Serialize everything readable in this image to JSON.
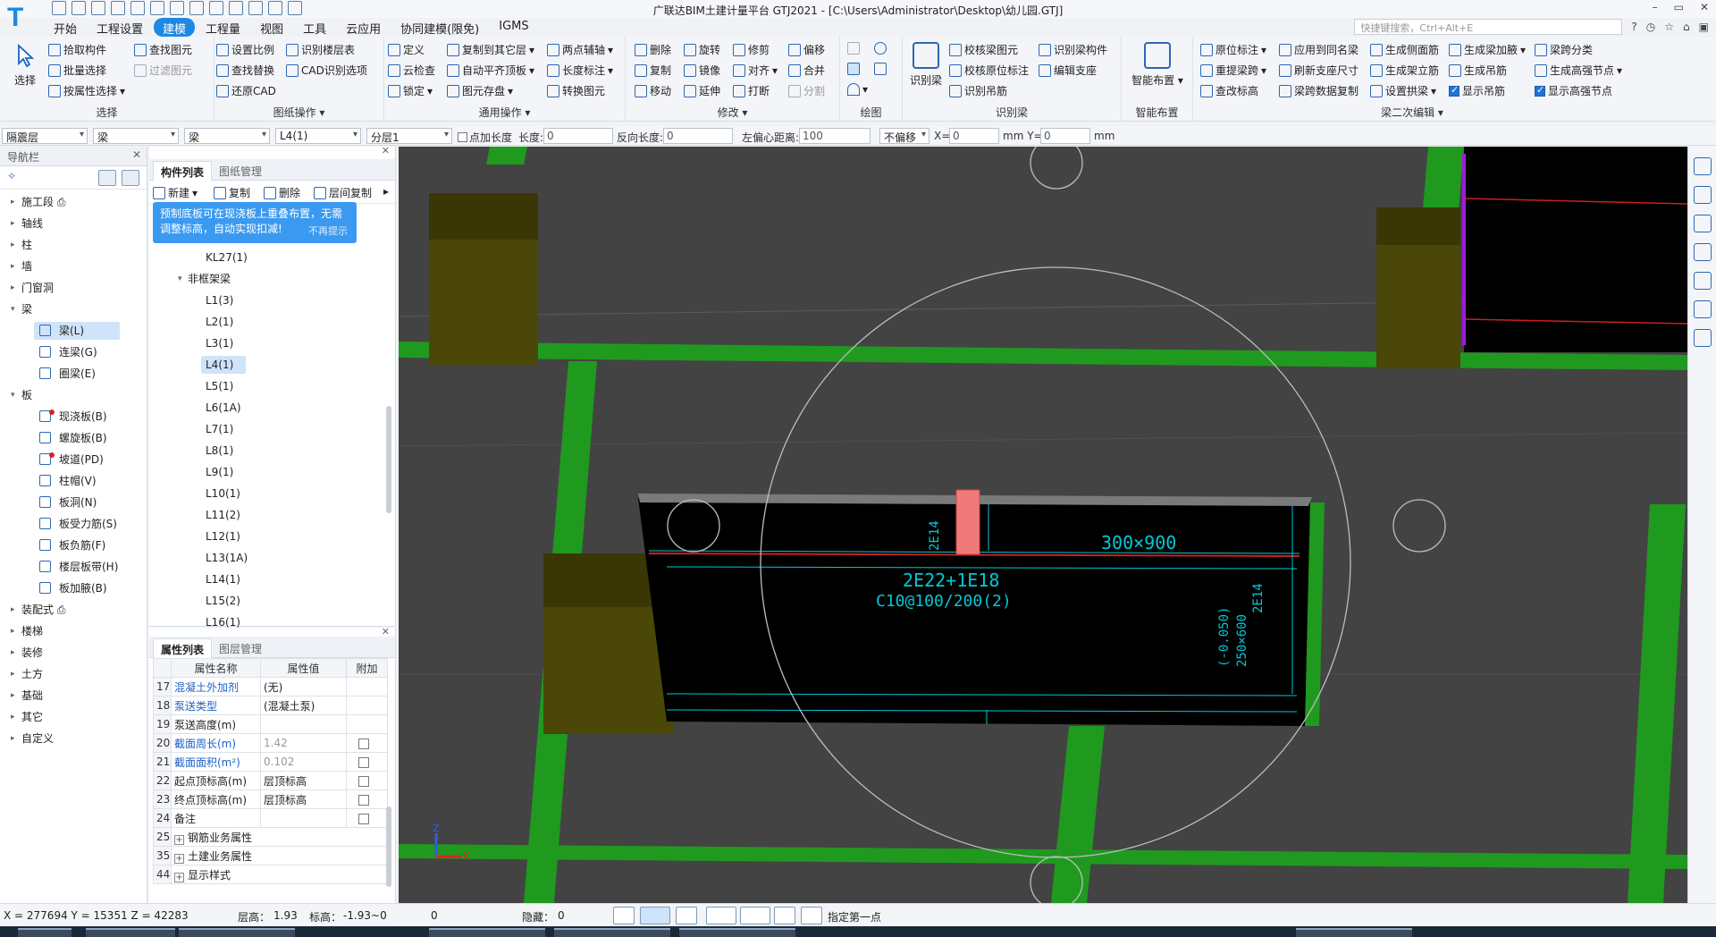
{
  "window": {
    "title": "广联达BIM土建计量平台 GTJ2021 - [C:\\Users\\Administrator\\Desktop\\幼儿园.GTJ]",
    "logo": "T",
    "quick_access_icons": [
      "new-file-icon",
      "open-folder-icon",
      "save-icon",
      "print-icon",
      "view-icon",
      "undo-icon",
      "redo-icon",
      "sum-icon",
      "grid-icon",
      "table-icon",
      "report-icon",
      "settings-icon",
      "dropdown-icon"
    ],
    "window_buttons": [
      "?",
      "◷",
      "☆",
      "⌂",
      "▣"
    ]
  },
  "menu": {
    "tabs": [
      {
        "label": "开始"
      },
      {
        "label": "工程设置"
      },
      {
        "label": "建模",
        "active": true
      },
      {
        "label": "工程量"
      },
      {
        "label": "视图"
      },
      {
        "label": "工具"
      },
      {
        "label": "云应用"
      },
      {
        "label": "协同建模(限免)"
      },
      {
        "label": "IGMS"
      }
    ],
    "search_placeholder": "快捷键搜索，Ctrl+Alt+E"
  },
  "ribbon": {
    "select_big": "选择",
    "select_group": {
      "title": "选择",
      "items": [
        "拾取构件",
        "批量选择",
        "按属性选择",
        "查找图元",
        "过滤图元"
      ]
    },
    "drawing_group": {
      "title": "图纸操作",
      "items": [
        "设置比例",
        "查找替换",
        "还原CAD",
        "识别楼层表",
        "CAD识别选项"
      ]
    },
    "common_group": {
      "title": "通用操作",
      "items": [
        "定义",
        "云检查",
        "锁定",
        "复制到其它层",
        "自动平齐顶板",
        "图元存盘",
        "两点辅轴",
        "长度标注",
        "转换图元"
      ]
    },
    "modify_group": {
      "title": "修改",
      "items": [
        "删除",
        "旋转",
        "修剪",
        "偏移",
        "复制",
        "镜像",
        "对齐",
        "合并",
        "移动",
        "延伸",
        "打断",
        "分割"
      ]
    },
    "draw_group": {
      "title": "绘图"
    },
    "identify_group": {
      "title": "识别梁",
      "big": "识别梁",
      "items": [
        "校核梁图元",
        "校核原位标注",
        "识别吊筋",
        "识别梁构件",
        "编辑支座"
      ]
    },
    "smart_group": {
      "title": "智能布置",
      "big": "智能布置"
    },
    "beam2_group": {
      "title": "梁二次编辑",
      "items": [
        "原位标注",
        "重提梁跨",
        "查改标高",
        "应用到同名梁",
        "刷新支座尺寸",
        "梁跨数据复制",
        "生成侧面筋",
        "生成架立筋",
        "设置拱梁",
        "生成梁加腋",
        "生成吊筋",
        "显示吊筋",
        "梁跨分类",
        "生成高强节点",
        "显示高强节点"
      ]
    }
  },
  "propbar": {
    "floor": "隔震层",
    "type": "梁",
    "subtype": "梁",
    "component": "L4(1)",
    "layer": "分层1",
    "point_length_label": "点加长度",
    "length_label": "长度:",
    "length_value": "0",
    "reverse_label": "反向长度:",
    "reverse_value": "0",
    "left_offset_label": "左偏心距离:",
    "left_offset_value": "100",
    "offset_mode": "不偏移",
    "x_label": "X=",
    "x_value": "0",
    "mm_y_label": "mm Y=",
    "y_value": "0",
    "mm_label": "mm"
  },
  "nav": {
    "title": "导航栏",
    "items": [
      {
        "label": "施工段 ⎙",
        "arrow": "▸"
      },
      {
        "label": "轴线",
        "arrow": "▸"
      },
      {
        "label": "柱",
        "arrow": "▸"
      },
      {
        "label": "墙",
        "arrow": "▸"
      },
      {
        "label": "门窗洞",
        "arrow": "▸"
      },
      {
        "label": "梁",
        "arrow": "▾"
      },
      {
        "label": "梁(L)",
        "sub": true,
        "selected": true
      },
      {
        "label": "连梁(G)",
        "sub": true
      },
      {
        "label": "圈梁(E)",
        "sub": true
      },
      {
        "label": "板",
        "arrow": "▾"
      },
      {
        "label": "现浇板(B)",
        "sub": true,
        "dot": true
      },
      {
        "label": "螺旋板(B)",
        "sub": true
      },
      {
        "label": "坡道(PD)",
        "sub": true,
        "dot": true
      },
      {
        "label": "柱帽(V)",
        "sub": true
      },
      {
        "label": "板洞(N)",
        "sub": true
      },
      {
        "label": "板受力筋(S)",
        "sub": true
      },
      {
        "label": "板负筋(F)",
        "sub": true
      },
      {
        "label": "楼层板带(H)",
        "sub": true
      },
      {
        "label": "板加腋(B)",
        "sub": true
      },
      {
        "label": "装配式 ⎙",
        "arrow": "▸"
      },
      {
        "label": "楼梯",
        "arrow": "▸"
      },
      {
        "label": "装修",
        "arrow": "▸"
      },
      {
        "label": "土方",
        "arrow": "▸"
      },
      {
        "label": "基础",
        "arrow": "▸"
      },
      {
        "label": "其它",
        "arrow": "▸"
      },
      {
        "label": "自定义",
        "arrow": "▸"
      }
    ]
  },
  "complist": {
    "tabs": [
      "构件列表",
      "图纸管理"
    ],
    "tools": [
      "新建",
      "复制",
      "删除",
      "层间复制"
    ],
    "tooltip": "预制底板可在现浇板上重叠布置，无需调整标高，自动实现扣减!",
    "tooltip_dismiss": "不再提示",
    "items": [
      {
        "label": "KL27(1)"
      },
      {
        "label": "非框架梁",
        "group": true
      },
      {
        "label": "L1(3)"
      },
      {
        "label": "L2(1)"
      },
      {
        "label": "L3(1)"
      },
      {
        "label": "L4(1)",
        "selected": true
      },
      {
        "label": "L5(1)"
      },
      {
        "label": "L6(1A)"
      },
      {
        "label": "L7(1)"
      },
      {
        "label": "L8(1)"
      },
      {
        "label": "L9(1)"
      },
      {
        "label": "L10(1)"
      },
      {
        "label": "L11(2)"
      },
      {
        "label": "L12(1)"
      },
      {
        "label": "L13(1A)"
      },
      {
        "label": "L14(1)"
      },
      {
        "label": "L15(2)"
      },
      {
        "label": "L16(1)"
      }
    ]
  },
  "attrs": {
    "tabs": [
      "属性列表",
      "图层管理"
    ],
    "headers": [
      "属性名称",
      "属性值",
      "附加"
    ],
    "rows": [
      {
        "num": "17",
        "name": "混凝土外加剂",
        "value": "(无)",
        "blue": true,
        "check": false
      },
      {
        "num": "18",
        "name": "泵送类型",
        "value": "(混凝土泵)",
        "blue": true,
        "check": false
      },
      {
        "num": "19",
        "name": "泵送高度(m)",
        "value": "",
        "check": false
      },
      {
        "num": "20",
        "name": "截面周长(m)",
        "value": "1.42",
        "blue": true,
        "gray": true,
        "check": true
      },
      {
        "num": "21",
        "name": "截面面积(m²)",
        "value": "0.102",
        "blue": true,
        "gray": true,
        "check": true
      },
      {
        "num": "22",
        "name": "起点顶标高(m)",
        "value": "层顶标高",
        "check": true
      },
      {
        "num": "23",
        "name": "终点顶标高(m)",
        "value": "层顶标高",
        "check": true
      },
      {
        "num": "24",
        "name": "备注",
        "value": "",
        "check": true
      },
      {
        "num": "25",
        "name": "钢筋业务属性",
        "value": "",
        "plus": true
      },
      {
        "num": "35",
        "name": "土建业务属性",
        "value": "",
        "plus": true
      },
      {
        "num": "44",
        "name": "显示样式",
        "value": "",
        "plus": true
      }
    ]
  },
  "canvas": {
    "annotations": {
      "size": "300×900",
      "rebar_main": "2E22+1E18",
      "stirrup": "C10@100/200(2)",
      "side_left": "2E14",
      "side_right": "2E14",
      "elev": "(-0.050)",
      "beam2": "250×600"
    },
    "axis": {
      "z": "Z",
      "x": "X"
    }
  },
  "status": {
    "coords": "X = 277694 Y = 15351 Z = 42283",
    "floor_height_label": "层高：",
    "floor_height": "1.93",
    "elevation_label": "标高：",
    "elevation": "-1.93~0",
    "count": "0",
    "hidden_label": "隐藏：",
    "hidden": "0",
    "prompt": "指定第一点"
  }
}
